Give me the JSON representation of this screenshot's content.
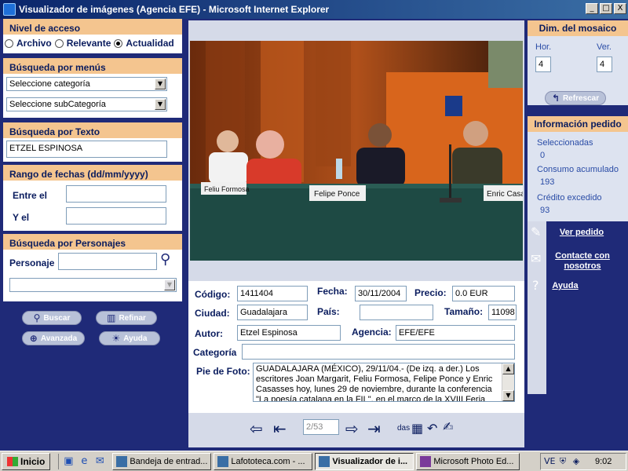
{
  "window": {
    "title": "Visualizador de imágenes (Agencia EFE) - Microsoft Internet Explorer",
    "minimize": "_",
    "maximize": "□",
    "close": "X"
  },
  "access": {
    "title": "Nivel de acceso",
    "options": [
      "Archivo",
      "Relevante",
      "Actualidad"
    ],
    "selected": "Actualidad"
  },
  "menu_search": {
    "title": "Búsqueda por menús",
    "category": "Seleccione categoría",
    "subcategory": "Seleccione subCategoría"
  },
  "text_search": {
    "title": "Búsqueda por Texto",
    "value": "ETZEL ESPINOSA"
  },
  "date_range": {
    "title": "Rango de fechas (dd/mm/yyyy)",
    "from_label": "Entre el",
    "to_label": "Y el",
    "from_value": "",
    "to_value": ""
  },
  "people_search": {
    "title": "Búsqueda por Personajes",
    "label": "Personaje",
    "value": "",
    "list_value": ""
  },
  "buttons": {
    "search": "Buscar",
    "refine": "Refinar",
    "advanced": "Avanzada",
    "help": "Ayuda"
  },
  "photo": {
    "nameplates": [
      "Feliu Formosa",
      "Felipe Ponce",
      "Enric Casa"
    ]
  },
  "details": {
    "code_label": "Código:",
    "code": "1411404",
    "date_label": "Fecha:",
    "date": "30/11/2004",
    "price_label": "Precio:",
    "price": "0.0 EUR",
    "city_label": "Ciudad:",
    "city": "Guadalajara",
    "country_label": "País:",
    "country": "",
    "size_label": "Tamaño:",
    "size": "11098",
    "author_label": "Autor:",
    "author": "Etzel Espinosa",
    "agency_label": "Agencia:",
    "agency": "EFE/EFE",
    "category_label": "Categoría",
    "category": "",
    "caption_label": "Pie de Foto:",
    "caption": "GUADALAJARA (MÉXICO), 29/11/04.- (De izq. a der.) Los escritores Joan Margarit, Feliu Formosa, Felipe Ponce y Enric Casasses hoy, lunes 29 de noviembre, durante la conferencia \"La poesía catalana en la FIL\", en el marco de la XVIII Feria"
  },
  "pager": {
    "value": "2/53",
    "suffix": "das"
  },
  "mosaic": {
    "title": "Dim. del mosaico",
    "hor_label": "Hor.",
    "ver_label": "Ver.",
    "hor": "4",
    "ver": "4",
    "refresh": "Refrescar"
  },
  "order": {
    "title": "Información pedido",
    "selected_label": "Seleccionadas",
    "selected": "0",
    "consumption_label": "Consumo acumulado",
    "consumption": "193",
    "credit_label": "Crédito excedido",
    "credit": "93"
  },
  "links": {
    "view_order": "Ver pedido",
    "contact_1": "Contacte con",
    "contact_2": "nosotros",
    "help": "Ayuda"
  },
  "taskbar": {
    "start": "Inicio",
    "tasks": [
      "Bandeja de entrad...",
      "Lafototeca.com - ...",
      "Visualizador de i...",
      "Microsoft Photo Ed..."
    ],
    "active": "Visualizador de i...",
    "tray_text": "VE",
    "clock": "9:02"
  }
}
